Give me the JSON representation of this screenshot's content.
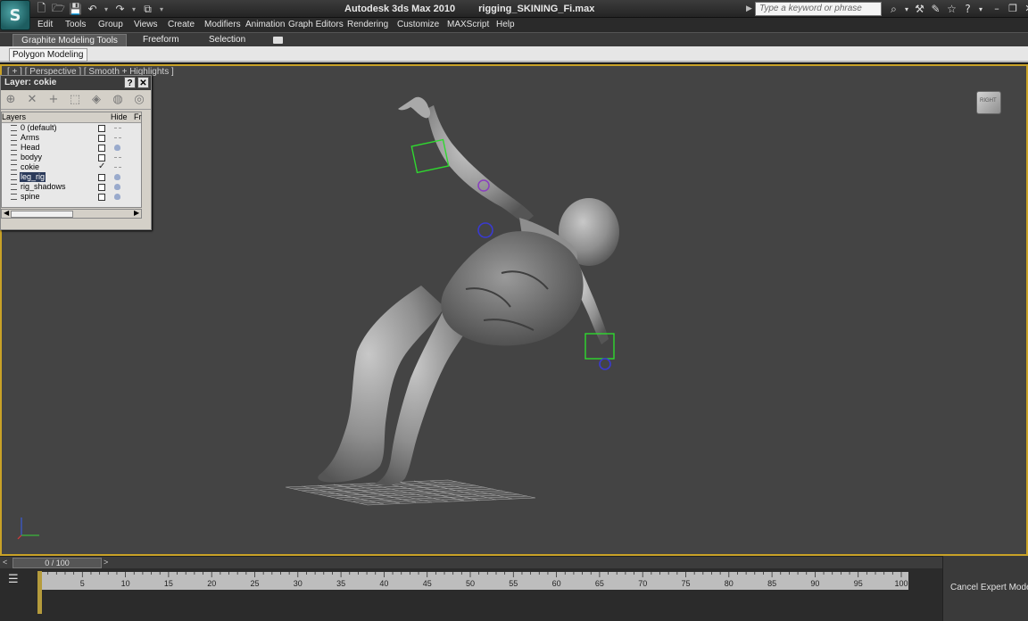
{
  "titlebar": {
    "app_title": "Autodesk 3ds Max  2010",
    "file_name": "rigging_SKINING_Fi.max",
    "search_placeholder": "Type a keyword or phrase",
    "app_logo_letter": "S"
  },
  "menus": [
    "Edit",
    "Tools",
    "Group",
    "Views",
    "Create",
    "Modifiers",
    "Animation",
    "Graph Editors",
    "Rendering",
    "Customize",
    "MAXScript",
    "Help"
  ],
  "ribbon": {
    "tabs": [
      "Graphite Modeling Tools",
      "Freeform",
      "Selection"
    ],
    "active_tab": "Graphite Modeling Tools",
    "panel": "Polygon Modeling"
  },
  "viewport": {
    "label": "[ + ] [ Perspective ] [ Smooth + Highlights ]",
    "viewcube_label": "RIGHT"
  },
  "layer_manager": {
    "title": "Layer: cokie",
    "help_btn": "?",
    "close_btn": "✕",
    "columns": {
      "layers": "Layers",
      "hide": "Hide",
      "freeze": "Fr"
    },
    "layers": [
      {
        "name": "0 (default)",
        "hidden": false,
        "frozen": false,
        "selected": false
      },
      {
        "name": "Arms",
        "hidden": false,
        "frozen": false,
        "selected": false
      },
      {
        "name": "Head",
        "hidden": false,
        "frozen": true,
        "selected": false
      },
      {
        "name": "bodyy",
        "hidden": false,
        "frozen": false,
        "selected": false
      },
      {
        "name": "cokie",
        "hidden": true,
        "frozen": false,
        "selected": false
      },
      {
        "name": "leg_rig",
        "hidden": false,
        "frozen": true,
        "selected": true
      },
      {
        "name": "rig_shadows",
        "hidden": false,
        "frozen": true,
        "selected": false
      },
      {
        "name": "spine",
        "hidden": false,
        "frozen": true,
        "selected": false
      }
    ]
  },
  "timeline": {
    "frame_display": "0 / 100",
    "prev": "<",
    "next": ">",
    "current_frame": 0,
    "ticks": [
      5,
      10,
      15,
      20,
      25,
      30,
      35,
      40,
      45,
      50,
      55,
      60,
      65,
      70,
      75,
      80,
      85,
      90,
      95,
      100
    ]
  },
  "status": {
    "cancel_expert_mode": "Cancel Expert Mode"
  }
}
